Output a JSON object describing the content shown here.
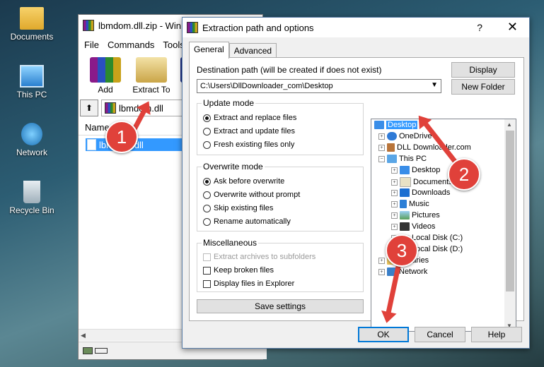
{
  "desktop": {
    "icons": [
      {
        "label": "Documents",
        "icon": "folder-icon"
      },
      {
        "label": "This PC",
        "icon": "computer-icon"
      },
      {
        "label": "Network",
        "icon": "network-icon"
      },
      {
        "label": "Recycle Bin",
        "icon": "recycle-bin-icon"
      }
    ]
  },
  "main_window": {
    "title": "lbmdom.dll.zip - Win",
    "menu": [
      "File",
      "Commands",
      "Tools"
    ],
    "toolbar": [
      "Add",
      "Extract To",
      "T"
    ],
    "path": "lbmdom.dll",
    "column_name": "Name",
    "file": "lbmdom.dll"
  },
  "dialog": {
    "title": "Extraction path and options",
    "help_glyph": "?",
    "close_glyph": "✕",
    "tabs": [
      "General",
      "Advanced"
    ],
    "dest_label": "Destination path (will be created if does not exist)",
    "dest_value": "C:\\Users\\DllDownloader_com\\Desktop",
    "buttons": {
      "display": "Display",
      "new_folder": "New Folder",
      "save_settings": "Save settings",
      "ok": "OK",
      "cancel": "Cancel",
      "help": "Help"
    },
    "update_mode": {
      "title": "Update mode",
      "options": [
        "Extract and replace files",
        "Extract and update files",
        "Fresh existing files only"
      ],
      "selected": 0
    },
    "overwrite_mode": {
      "title": "Overwrite mode",
      "options": [
        "Ask before overwrite",
        "Overwrite without prompt",
        "Skip existing files",
        "Rename automatically"
      ],
      "selected": 0
    },
    "misc": {
      "title": "Miscellaneous",
      "options": [
        {
          "label": "Extract archives to subfolders",
          "checked": false,
          "disabled": true
        },
        {
          "label": "Keep broken files",
          "checked": false,
          "disabled": false
        },
        {
          "label": "Display files in Explorer",
          "checked": false,
          "disabled": false
        }
      ]
    },
    "tree": [
      {
        "label": "Desktop",
        "selected": true,
        "icon": "desktop-icon"
      },
      {
        "label": "OneDrive",
        "icon": "onedrive-icon"
      },
      {
        "label": "DLL Downloader.com",
        "icon": "user-icon"
      },
      {
        "label": "This PC",
        "icon": "computer-icon"
      },
      {
        "label": "Desktop",
        "icon": "desktop-icon"
      },
      {
        "label": "Documents",
        "icon": "documents-icon"
      },
      {
        "label": "Downloads",
        "icon": "downloads-icon"
      },
      {
        "label": "Music",
        "icon": "music-icon"
      },
      {
        "label": "Pictures",
        "icon": "pictures-icon"
      },
      {
        "label": "Videos",
        "icon": "videos-icon"
      },
      {
        "label": "Local Disk (C:)",
        "icon": "drive-icon"
      },
      {
        "label": "Local Disk (D:)",
        "icon": "drive-icon"
      },
      {
        "label": "Libraries",
        "icon": "libraries-icon"
      },
      {
        "label": "Network",
        "icon": "network-icon"
      }
    ]
  },
  "steps": [
    "1",
    "2",
    "3"
  ],
  "colors": {
    "accent": "#3399ff",
    "step": "#e0413a"
  }
}
